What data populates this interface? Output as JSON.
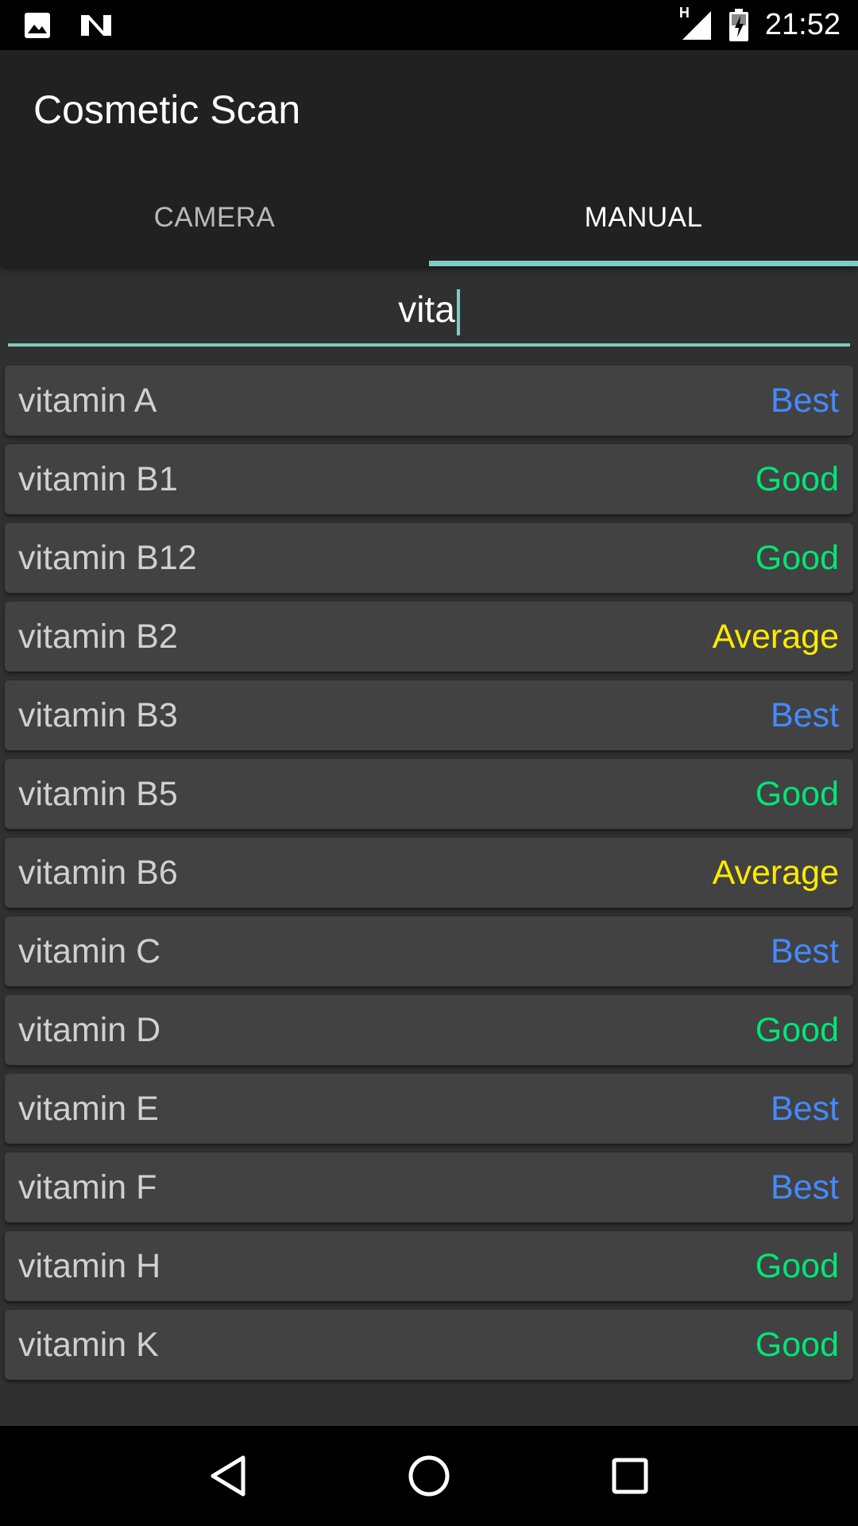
{
  "status_bar": {
    "time": "21:52",
    "network": "H"
  },
  "app": {
    "title": "Cosmetic Scan"
  },
  "tabs": [
    {
      "label": "CAMERA",
      "active": false
    },
    {
      "label": "MANUAL",
      "active": true
    }
  ],
  "search": {
    "value": "vita"
  },
  "ratings": {
    "Best": "#448aff",
    "Good": "#00e676",
    "Average": "#ffea00"
  },
  "ingredients": [
    {
      "name": "vitamin A",
      "rating": "Best"
    },
    {
      "name": "vitamin B1",
      "rating": "Good"
    },
    {
      "name": "vitamin B12",
      "rating": "Good"
    },
    {
      "name": "vitamin B2",
      "rating": "Average"
    },
    {
      "name": "vitamin B3",
      "rating": "Best"
    },
    {
      "name": "vitamin B5",
      "rating": "Good"
    },
    {
      "name": "vitamin B6",
      "rating": "Average"
    },
    {
      "name": "vitamin C",
      "rating": "Best"
    },
    {
      "name": "vitamin D",
      "rating": "Good"
    },
    {
      "name": "vitamin E",
      "rating": "Best"
    },
    {
      "name": "vitamin F",
      "rating": "Best"
    },
    {
      "name": "vitamin H",
      "rating": "Good"
    },
    {
      "name": "vitamin K",
      "rating": "Good"
    }
  ]
}
